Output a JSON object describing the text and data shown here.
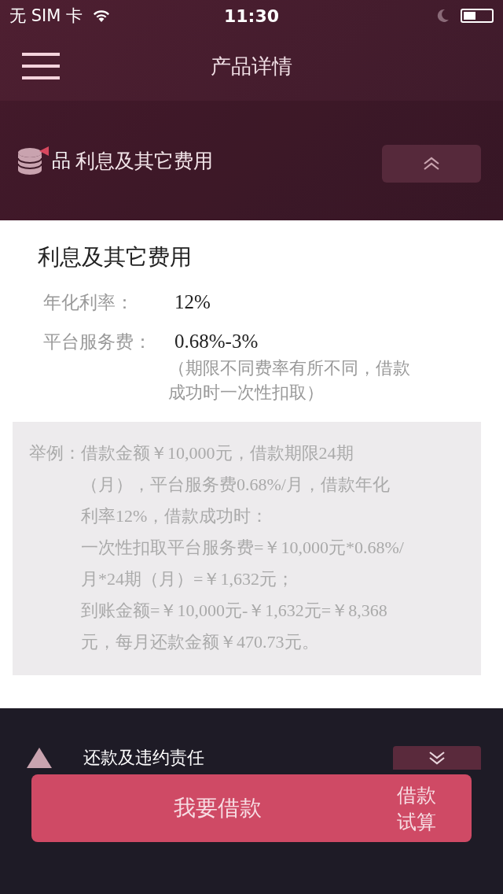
{
  "status_bar": {
    "carrier": "无 SIM 卡",
    "time": "11:30"
  },
  "nav": {
    "title": "产品详情"
  },
  "section": {
    "prefix": "品",
    "title": "利息及其它费用",
    "expanded": true
  },
  "detail": {
    "title": "利息及其它费用",
    "rows": [
      {
        "label": "年化利率：",
        "value": "12%"
      },
      {
        "label": "平台服务费：",
        "value": "0.68%-3%",
        "note_lines": [
          "（期限不同费率有所不同，借款",
          "成功时一次性扣取）"
        ]
      }
    ],
    "example": {
      "label": "举例：",
      "lines": [
        "借款金额￥10,000元，借款期限24期",
        "（月），平台服务费0.68%/月，借款年化",
        "利率12%，借款成功时：",
        "一次性扣取平台服务费=￥10,000元*0.68%/",
        "月*24期（月）=￥1,632元；",
        "到账金额=￥10,000元-￥1,632元=￥8,368",
        "元，每月还款金额￥470.73元。"
      ]
    }
  },
  "next_section": {
    "title": "还款及违约责任",
    "expanded": false
  },
  "actions": [
    {
      "kind": "primary",
      "label": "我要借款"
    },
    {
      "kind": "secondary",
      "label": "借款试算"
    }
  ]
}
